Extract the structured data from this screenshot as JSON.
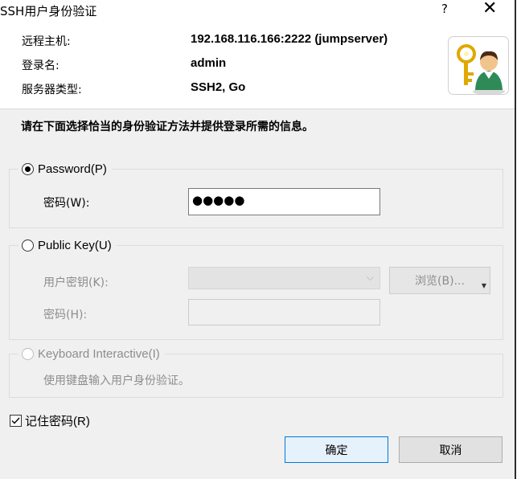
{
  "window": {
    "title": "SSH用户身份验证",
    "help": "?",
    "close": "✕"
  },
  "info": [
    {
      "label": "远程主机:",
      "value": "192.168.116.166:2222 (jumpserver)"
    },
    {
      "label": "登录名:",
      "value": "admin"
    },
    {
      "label": "服务器类型:",
      "value": "SSH2, Go"
    }
  ],
  "instruction": "请在下面选择恰当的身份验证方法并提供登录所需的信息。",
  "password_group": {
    "radio_label": "Password(P)",
    "selected": true,
    "field_label": "密码(W):",
    "field_value": "●●●●●"
  },
  "publickey_group": {
    "radio_label": "Public Key(U)",
    "selected": false,
    "userkey_label": "用户密钥(K):",
    "browse_label": "浏览(B)...",
    "passphrase_label": "密码(H):"
  },
  "keyboard_group": {
    "radio_label": "Keyboard Interactive(I)",
    "description": "使用键盘输入用户身份验证。"
  },
  "remember": {
    "label": "记住密码(R)",
    "checked": true
  },
  "buttons": {
    "ok": "确定",
    "cancel": "取消"
  }
}
